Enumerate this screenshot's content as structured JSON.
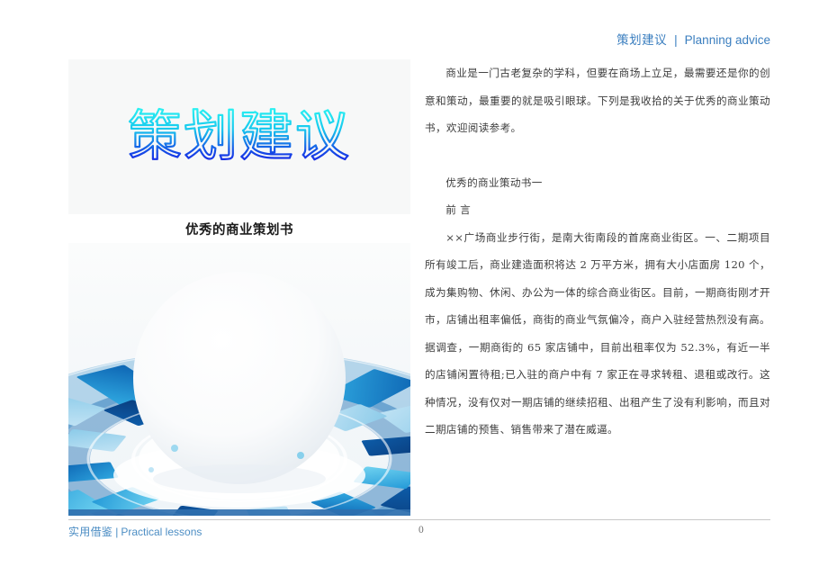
{
  "header": {
    "cn": "策划建议",
    "separator": "|",
    "en": "Planning advice",
    "accent_color": "#3a7ebf"
  },
  "figure": {
    "title_graphic_text": "策划建议",
    "title_gradient_from": "#22f0f0",
    "title_gradient_to": "#1a12e8",
    "caption": "优秀的商业策划书",
    "illustration_name": "blue-mosaic-ring-sphere",
    "illustration_colors": [
      "#0b4f9e",
      "#0d6cb8",
      "#1a8fd4",
      "#35b6e8",
      "#6fd3f0",
      "#a8dcf2",
      "#d7ebf6"
    ]
  },
  "body": {
    "paragraphs": [
      "商业是一门古老复杂的学科，但要在商场上立足，最需要还是你的创意和策动，最重要的就是吸引眼球。下列是我收拾的关于优秀的商业策动书，欢迎阅读参考。",
      "优秀的商业策动书一",
      "前 言",
      "××广场商业步行街，是南大街南段的首席商业街区。一、二期项目所有竣工后，商业建造面积将达 2 万平方米，拥有大小店面房 120 个，成为集购物、休闲、办公为一体的综合商业街区。目前，一期商街刚才开市，店铺出租率偏低，商街的商业气氛偏冷，商户入驻经营热烈没有高。据调查，一期商街的 65 家店铺中，目前出租率仅为 52.3%，有近一半的店铺闲置待租;已入驻的商户中有 7 家正在寻求转租、退租或改行。这种情况，没有仅对一期店铺的继续招租、出租产生了没有利影响，而且对二期店铺的预售、销售带来了潜在威逼。"
    ]
  },
  "footer": {
    "cn": "实用借鉴",
    "separator": "|",
    "en": "Practical lessons",
    "page_number": "0",
    "accent_color": "#4d8ec4"
  }
}
